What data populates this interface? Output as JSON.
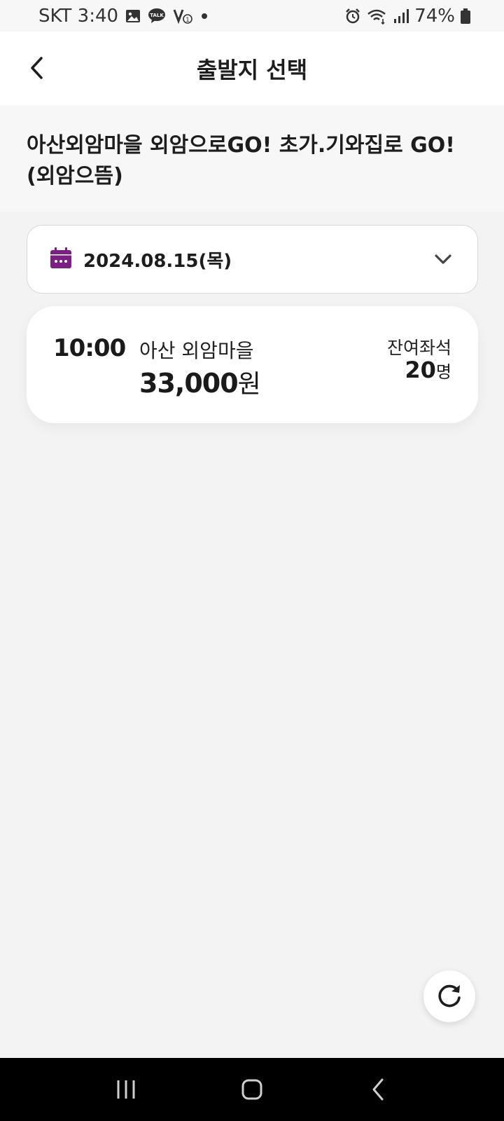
{
  "status_bar": {
    "carrier_time": "SKT 3:40",
    "battery": "74%",
    "left_icons": [
      "gallery-icon",
      "kakaotalk-icon",
      "volte-icon",
      "dot-icon"
    ],
    "right_icons": [
      "alarm-icon",
      "wifi-icon",
      "signal-icon",
      "battery-icon"
    ]
  },
  "app_bar": {
    "title": "출발지 선택"
  },
  "route": {
    "title_line1": "아산외암마을 외암으로GO! 초가.기와집로 GO!",
    "title_line2": "(외암으뜸)"
  },
  "date_selector": {
    "value": "2024.08.15(목)"
  },
  "trips": [
    {
      "time": "10:00",
      "departure": "아산 외암마을",
      "price": "33,000",
      "price_unit": "원",
      "seats_label": "잔여좌석",
      "seats": "20",
      "seats_unit": "명"
    }
  ],
  "colors": {
    "accent": "#7b1f82",
    "background": "#f3f3f3",
    "card": "#ffffff"
  }
}
